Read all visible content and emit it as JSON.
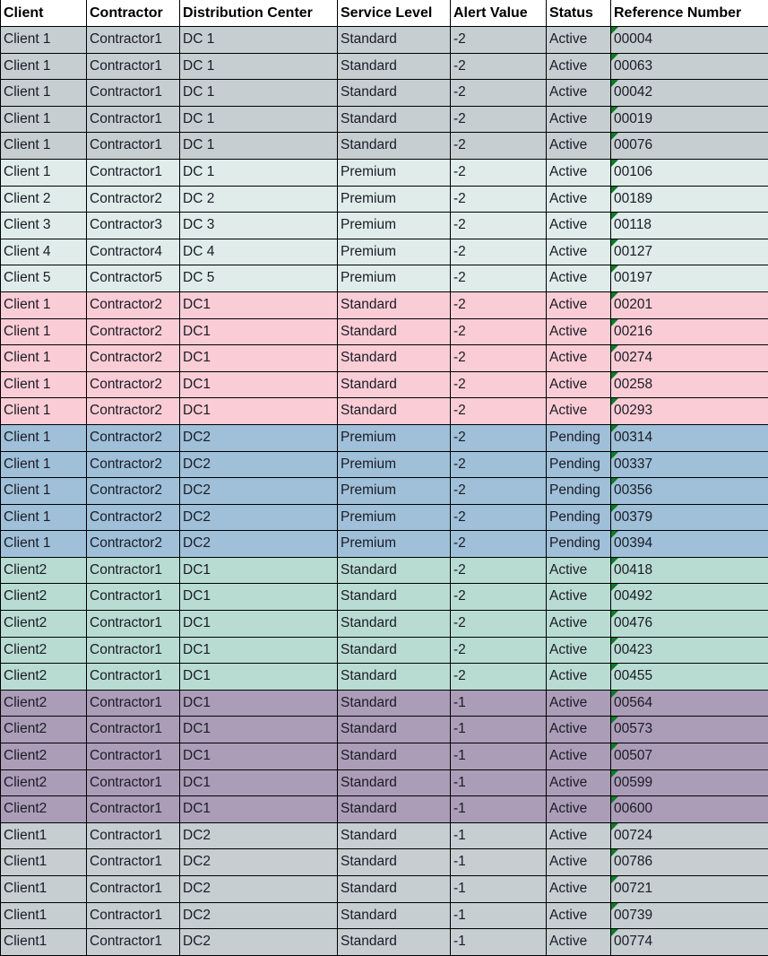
{
  "table": {
    "columns": [
      {
        "key": "client",
        "label": "Client"
      },
      {
        "key": "contractor",
        "label": "Contractor"
      },
      {
        "key": "dc",
        "label": "Distribution Center"
      },
      {
        "key": "service",
        "label": "Service Level"
      },
      {
        "key": "alert",
        "label": "Alert Value"
      },
      {
        "key": "status",
        "label": "Status"
      },
      {
        "key": "ref",
        "label": "Reference Number"
      }
    ],
    "cell_marker_icon": "green-triangle-icon",
    "band_colors": {
      "gray": "#c6ced1",
      "mint": "#dfecea",
      "pink": "#facdd6",
      "blue": "#9fc0d8",
      "teal": "#b9dcd2",
      "purple": "#ab9db8",
      "gray2": "#c6ced1"
    },
    "rows": [
      {
        "band": "gray",
        "client": "Client 1",
        "contractor": "Contractor1",
        "dc": "DC 1",
        "service": "Standard",
        "alert": "-2",
        "status": "Active",
        "ref": "00004"
      },
      {
        "band": "gray",
        "client": "Client 1",
        "contractor": "Contractor1",
        "dc": "DC 1",
        "service": "Standard",
        "alert": "-2",
        "status": "Active",
        "ref": "00063"
      },
      {
        "band": "gray",
        "client": "Client 1",
        "contractor": "Contractor1",
        "dc": "DC 1",
        "service": "Standard",
        "alert": "-2",
        "status": "Active",
        "ref": "00042"
      },
      {
        "band": "gray",
        "client": "Client 1",
        "contractor": "Contractor1",
        "dc": "DC 1",
        "service": "Standard",
        "alert": "-2",
        "status": "Active",
        "ref": "00019"
      },
      {
        "band": "gray",
        "client": "Client 1",
        "contractor": "Contractor1",
        "dc": "DC 1",
        "service": "Standard",
        "alert": "-2",
        "status": "Active",
        "ref": "00076"
      },
      {
        "band": "mint",
        "client": "Client 1",
        "contractor": "Contractor1",
        "dc": "DC 1",
        "service": "Premium",
        "alert": "-2",
        "status": "Active",
        "ref": "00106"
      },
      {
        "band": "mint",
        "client": "Client 2",
        "contractor": "Contractor2",
        "dc": "DC 2",
        "service": "Premium",
        "alert": "-2",
        "status": "Active",
        "ref": "00189"
      },
      {
        "band": "mint",
        "client": "Client 3",
        "contractor": "Contractor3",
        "dc": "DC 3",
        "service": "Premium",
        "alert": "-2",
        "status": "Active",
        "ref": "00118"
      },
      {
        "band": "mint",
        "client": "Client 4",
        "contractor": "Contractor4",
        "dc": "DC 4",
        "service": "Premium",
        "alert": "-2",
        "status": "Active",
        "ref": "00127"
      },
      {
        "band": "mint",
        "client": "Client 5",
        "contractor": "Contractor5",
        "dc": "DC 5",
        "service": "Premium",
        "alert": "-2",
        "status": "Active",
        "ref": "00197"
      },
      {
        "band": "pink",
        "client": "Client 1",
        "contractor": "Contractor2",
        "dc": "DC1",
        "service": "Standard",
        "alert": "-2",
        "status": "Active",
        "ref": "00201"
      },
      {
        "band": "pink",
        "client": "Client 1",
        "contractor": "Contractor2",
        "dc": "DC1",
        "service": "Standard",
        "alert": "-2",
        "status": "Active",
        "ref": "00216"
      },
      {
        "band": "pink",
        "client": "Client 1",
        "contractor": "Contractor2",
        "dc": "DC1",
        "service": "Standard",
        "alert": "-2",
        "status": "Active",
        "ref": "00274"
      },
      {
        "band": "pink",
        "client": "Client 1",
        "contractor": "Contractor2",
        "dc": "DC1",
        "service": "Standard",
        "alert": "-2",
        "status": "Active",
        "ref": "00258"
      },
      {
        "band": "pink",
        "client": "Client 1",
        "contractor": "Contractor2",
        "dc": "DC1",
        "service": "Standard",
        "alert": "-2",
        "status": "Active",
        "ref": "00293"
      },
      {
        "band": "blue",
        "client": "Client 1",
        "contractor": "Contractor2",
        "dc": "DC2",
        "service": "Premium",
        "alert": "-2",
        "status": "Pending",
        "ref": "00314"
      },
      {
        "band": "blue",
        "client": "Client 1",
        "contractor": "Contractor2",
        "dc": "DC2",
        "service": "Premium",
        "alert": "-2",
        "status": "Pending",
        "ref": "00337"
      },
      {
        "band": "blue",
        "client": "Client 1",
        "contractor": "Contractor2",
        "dc": "DC2",
        "service": "Premium",
        "alert": "-2",
        "status": "Pending",
        "ref": "00356"
      },
      {
        "band": "blue",
        "client": "Client 1",
        "contractor": "Contractor2",
        "dc": "DC2",
        "service": "Premium",
        "alert": "-2",
        "status": "Pending",
        "ref": "00379"
      },
      {
        "band": "blue",
        "client": "Client 1",
        "contractor": "Contractor2",
        "dc": "DC2",
        "service": "Premium",
        "alert": "-2",
        "status": "Pending",
        "ref": "00394"
      },
      {
        "band": "teal",
        "client": "Client2",
        "contractor": "Contractor1",
        "dc": "DC1",
        "service": "Standard",
        "alert": "-2",
        "status": "Active",
        "ref": "00418"
      },
      {
        "band": "teal",
        "client": "Client2",
        "contractor": "Contractor1",
        "dc": "DC1",
        "service": "Standard",
        "alert": "-2",
        "status": "Active",
        "ref": "00492"
      },
      {
        "band": "teal",
        "client": "Client2",
        "contractor": "Contractor1",
        "dc": "DC1",
        "service": "Standard",
        "alert": "-2",
        "status": "Active",
        "ref": "00476"
      },
      {
        "band": "teal",
        "client": "Client2",
        "contractor": "Contractor1",
        "dc": "DC1",
        "service": "Standard",
        "alert": "-2",
        "status": "Active",
        "ref": "00423"
      },
      {
        "band": "teal",
        "client": "Client2",
        "contractor": "Contractor1",
        "dc": "DC1",
        "service": "Standard",
        "alert": "-2",
        "status": "Active",
        "ref": "00455"
      },
      {
        "band": "purple",
        "client": "Client2",
        "contractor": "Contractor1",
        "dc": "DC1",
        "service": "Standard",
        "alert": "-1",
        "status": "Active",
        "ref": "00564"
      },
      {
        "band": "purple",
        "client": "Client2",
        "contractor": "Contractor1",
        "dc": "DC1",
        "service": "Standard",
        "alert": "-1",
        "status": "Active",
        "ref": "00573"
      },
      {
        "band": "purple",
        "client": "Client2",
        "contractor": "Contractor1",
        "dc": "DC1",
        "service": "Standard",
        "alert": "-1",
        "status": "Active",
        "ref": "00507"
      },
      {
        "band": "purple",
        "client": "Client2",
        "contractor": "Contractor1",
        "dc": "DC1",
        "service": "Standard",
        "alert": "-1",
        "status": "Active",
        "ref": "00599"
      },
      {
        "band": "purple",
        "client": "Client2",
        "contractor": "Contractor1",
        "dc": "DC1",
        "service": "Standard",
        "alert": "-1",
        "status": "Active",
        "ref": "00600"
      },
      {
        "band": "gray2",
        "client": "Client1",
        "contractor": "Contractor1",
        "dc": "DC2",
        "service": "Standard",
        "alert": "-1",
        "status": "Active",
        "ref": "00724"
      },
      {
        "band": "gray2",
        "client": "Client1",
        "contractor": "Contractor1",
        "dc": "DC2",
        "service": "Standard",
        "alert": "-1",
        "status": "Active",
        "ref": "00786"
      },
      {
        "band": "gray2",
        "client": "Client1",
        "contractor": "Contractor1",
        "dc": "DC2",
        "service": "Standard",
        "alert": "-1",
        "status": "Active",
        "ref": "00721"
      },
      {
        "band": "gray2",
        "client": "Client1",
        "contractor": "Contractor1",
        "dc": "DC2",
        "service": "Standard",
        "alert": "-1",
        "status": "Active",
        "ref": "00739"
      },
      {
        "band": "gray2",
        "client": "Client1",
        "contractor": "Contractor1",
        "dc": "DC2",
        "service": "Standard",
        "alert": "-1",
        "status": "Active",
        "ref": "00774"
      }
    ]
  }
}
